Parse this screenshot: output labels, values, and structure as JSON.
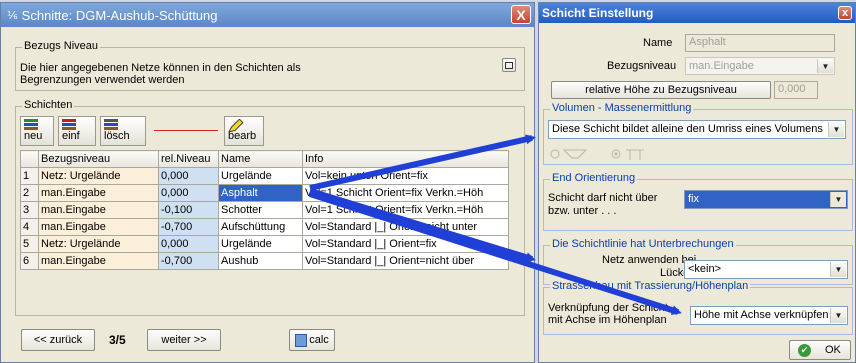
{
  "main_window": {
    "title": "Schnitte: DGM-Aushub-Schüttung",
    "close_label": "X",
    "bezugs_group": {
      "title": "Bezugs Niveau",
      "description_line1": "Die hier angegebenen Netze können  in den Schichten als",
      "description_line2": "Begrenzungen verwendet werden"
    },
    "schichten_group": {
      "title": "Schichten",
      "toolbar": {
        "neu": "neu",
        "einf": "einf",
        "losch": "lösch",
        "bearb": "bearb"
      },
      "columns": [
        "Bezugsniveau",
        "rel.Niveau",
        "Name",
        "Info"
      ],
      "rows": [
        {
          "n": "1",
          "bez": "Netz: Urgelände",
          "niv": "0,000",
          "name": "Urgelände",
          "info": "Vol=kein unten Orient=fix"
        },
        {
          "n": "2",
          "bez": "man.Eingabe",
          "niv": "0,000",
          "name": "Asphalt",
          "info": "Vol=1 Schicht Orient=fix Verkn.=Höh"
        },
        {
          "n": "3",
          "bez": "man.Eingabe",
          "niv": "-0,100",
          "name": "Schotter",
          "info": "Vol=1 Schicht Orient=fix Verkn.=Höh"
        },
        {
          "n": "4",
          "bez": "man.Eingabe",
          "niv": "-0,700",
          "name": "Aufschüttung",
          "info": "Vol=Standard |_| Orient=nicht unter"
        },
        {
          "n": "5",
          "bez": "Netz: Urgelände",
          "niv": "0,000",
          "name": "Urgelände",
          "info": "Vol=Standard |_| Orient=fix"
        },
        {
          "n": "6",
          "bez": "man.Eingabe",
          "niv": "-0,700",
          "name": "Aushub",
          "info": "Vol=Standard |_| Orient=nicht über"
        }
      ]
    },
    "footer": {
      "back": "<< zurück",
      "page": "3/5",
      "next": "weiter >>",
      "calc": "calc"
    }
  },
  "settings_window": {
    "title": "Schicht Einstellung",
    "close_label": "x",
    "name_label": "Name",
    "name_value": "Asphalt",
    "bezug_label": "Bezugsniveau",
    "bezug_value": "man.Eingabe",
    "relhoehe_button": "relative Höhe zu Bezugsniveau",
    "relhoehe_value": "0,000",
    "volumen_group": {
      "title": "Volumen - Massenermittlung",
      "selected": "Diese Schicht bildet alleine den Umriss eines Volumens"
    },
    "orient_group": {
      "title": "End Orientierung",
      "label_line1": "Schicht darf nicht über",
      "label_line2": "bzw. unter . . .",
      "selected": "fix"
    },
    "unterbrechung_group": {
      "title": "Die Schichtlinie hat Unterbrechungen",
      "label_line1": "Netz anwenden bei",
      "label_line2": "Lücke",
      "selected": "<kein>"
    },
    "trassierung_group": {
      "title": "Strassenbau mit Trassierung/Höhenplan",
      "label_line1": "Verknüpfung der Schicht",
      "label_line2": "mit Achse im Höhenplan",
      "selected": "Höhe mit Achse verknüpfen"
    },
    "ok_label": "OK"
  },
  "colors": {
    "arrow": "#1f3fd6",
    "selection": "#3163c5",
    "group_title": "#0b3fa8"
  },
  "icons": [
    "ruler-icon",
    "new-layer-icon",
    "insert-layer-icon",
    "delete-layer-icon",
    "edit-pencil-icon",
    "calc-icon",
    "ok-check-icon",
    "dropdown-arrow-icon"
  ]
}
